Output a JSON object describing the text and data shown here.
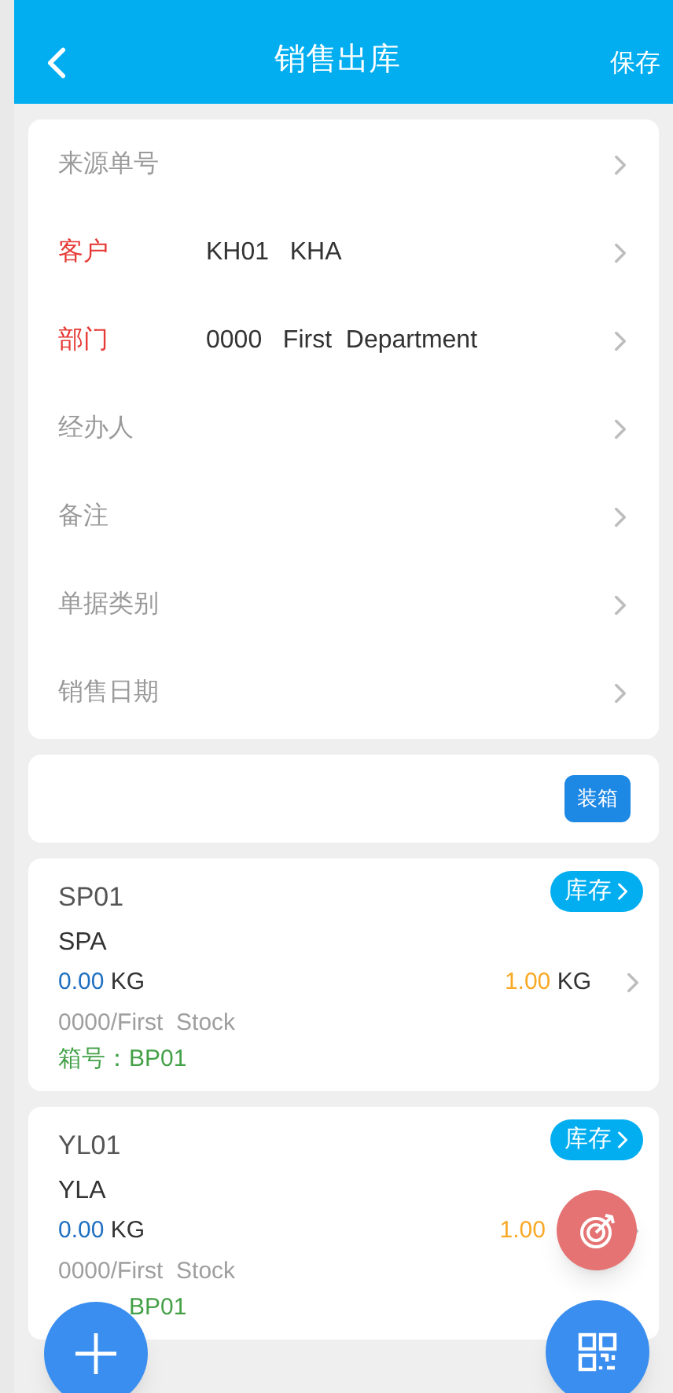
{
  "header": {
    "title": "销售出库",
    "action": "保存"
  },
  "form": [
    {
      "label": "来源单号",
      "required": false
    },
    {
      "label": "客户",
      "required": true,
      "value": "KH01   KHA"
    },
    {
      "label": "部门",
      "required": true,
      "value": "0000   First  Department"
    },
    {
      "label": "经办人",
      "required": false
    },
    {
      "label": "备注",
      "required": false
    },
    {
      "label": "单据类别",
      "required": false
    },
    {
      "label": "销售日期",
      "required": false
    }
  ],
  "packing_button": "装箱",
  "items": [
    {
      "code": "SP01",
      "name": "SPA",
      "stock_button": "库存",
      "qty": "0.00",
      "qty_unit": "KG",
      "plan": "1.00",
      "plan_unit": "KG",
      "warehouse": "0000/First  Stock",
      "box_label": "箱号：",
      "box": "BP01"
    },
    {
      "code": "YL01",
      "name": "YLA",
      "stock_button": "库存",
      "qty": "0.00",
      "qty_unit": "KG",
      "plan": "1.00",
      "warehouse": "0000/First  Stock",
      "box": "BP01"
    }
  ]
}
